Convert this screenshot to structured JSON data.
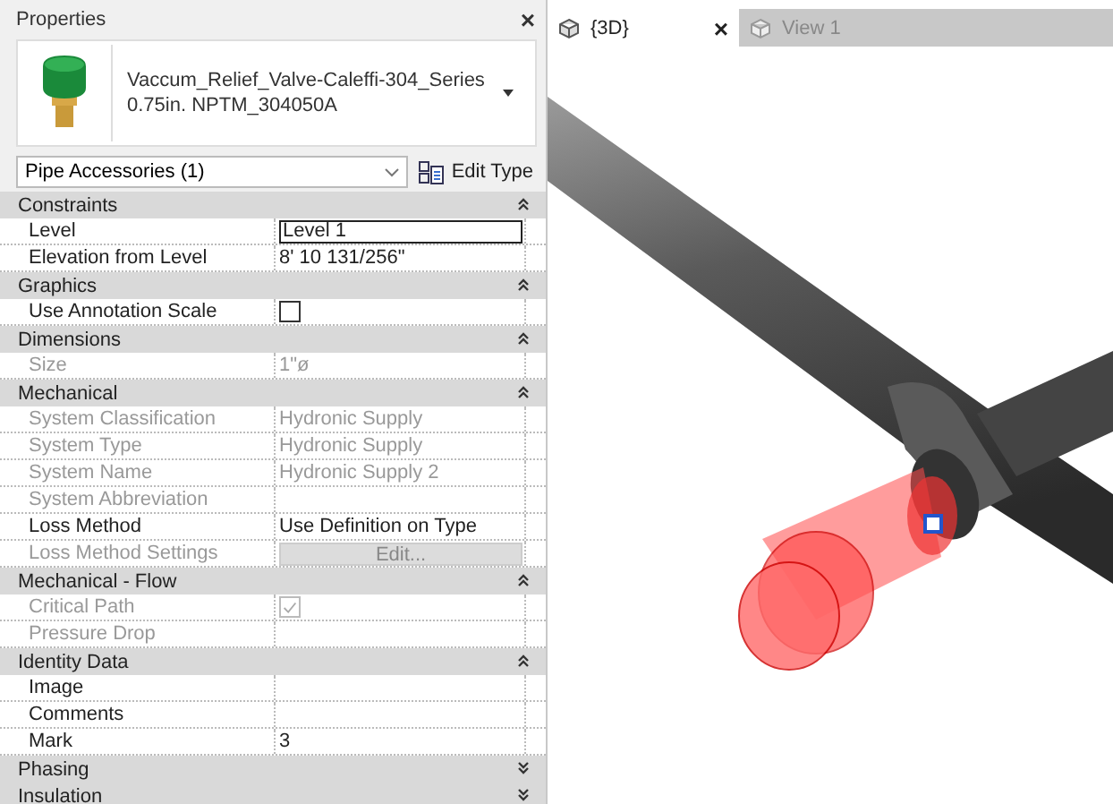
{
  "properties_panel": {
    "title": "Properties",
    "close": "×",
    "type_selector": {
      "name_line_1": "Vaccum_Relief_Valve-Caleffi-304_Series",
      "name_line_2": "0.75in. NPTM_304050A"
    },
    "category_filter": {
      "value": "Pipe Accessories (1)"
    },
    "edit_type_button": "Edit Type",
    "sections": [
      {
        "name": "Constraints",
        "expanded": true,
        "rows": [
          {
            "label": "Level",
            "value": "Level 1",
            "kind": "field",
            "disabled": false
          },
          {
            "label": "Elevation from Level",
            "value": "8'  10 131/256\"",
            "kind": "text",
            "disabled": false
          }
        ]
      },
      {
        "name": "Graphics",
        "expanded": true,
        "rows": [
          {
            "label": "Use Annotation Scale",
            "kind": "checkbox",
            "checked": false,
            "disabled": false
          }
        ]
      },
      {
        "name": "Dimensions",
        "expanded": true,
        "rows": [
          {
            "label": "Size",
            "value": "1\"ø",
            "kind": "text",
            "disabled": true
          }
        ]
      },
      {
        "name": "Mechanical",
        "expanded": true,
        "rows": [
          {
            "label": "System Classification",
            "value": "Hydronic Supply",
            "kind": "text",
            "disabled": true
          },
          {
            "label": "System Type",
            "value": "Hydronic Supply",
            "kind": "text",
            "disabled": true
          },
          {
            "label": "System Name",
            "value": "Hydronic Supply 2",
            "kind": "text",
            "disabled": true
          },
          {
            "label": "System Abbreviation",
            "kind": "text",
            "disabled": true
          },
          {
            "label": "Loss Method",
            "value": "Use Definition on Type",
            "kind": "text",
            "disabled": false
          },
          {
            "label": "Loss Method Settings",
            "value": "Edit...",
            "kind": "button",
            "disabled": true
          }
        ]
      },
      {
        "name": "Mechanical - Flow",
        "expanded": true,
        "rows": [
          {
            "label": "Critical Path",
            "kind": "checkbox",
            "checked": true,
            "disabled": true
          },
          {
            "label": "Pressure Drop",
            "kind": "text",
            "disabled": true
          }
        ]
      },
      {
        "name": "Identity Data",
        "expanded": true,
        "rows": [
          {
            "label": "Image",
            "kind": "text",
            "disabled": false
          },
          {
            "label": "Comments",
            "kind": "text",
            "disabled": false
          },
          {
            "label": "Mark",
            "value": "3",
            "kind": "text",
            "disabled": false
          }
        ]
      },
      {
        "name": "Phasing",
        "expanded": false
      },
      {
        "name": "Insulation",
        "expanded": false
      }
    ]
  },
  "view_tabs": [
    {
      "label": "{3D}",
      "selected": true,
      "close": "×"
    },
    {
      "label": "View 1",
      "selected": false
    }
  ]
}
